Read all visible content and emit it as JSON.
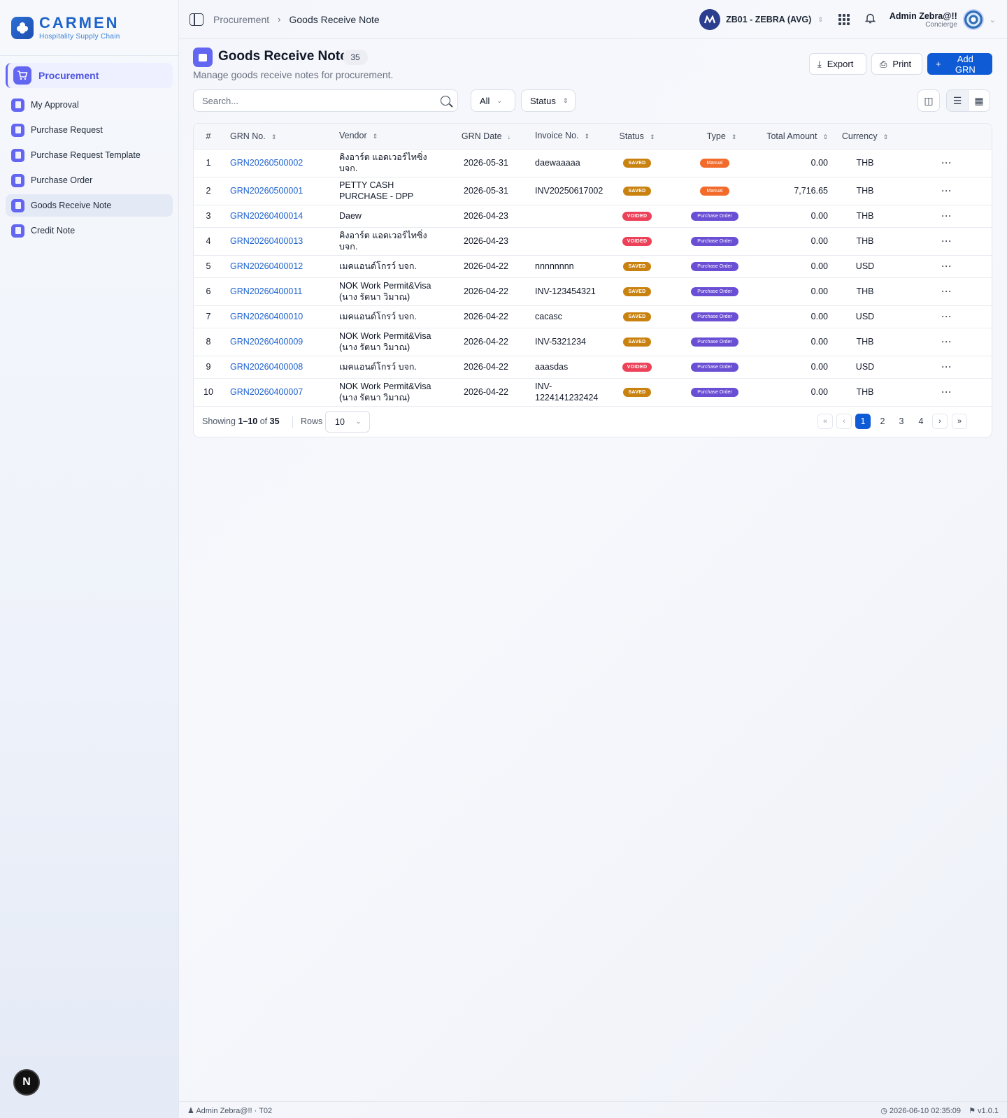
{
  "brand": {
    "name": "CARMEN",
    "tagline": "Hospitality Supply Chain"
  },
  "sidebar": {
    "section": "Procurement",
    "items": [
      {
        "label": "My Approval"
      },
      {
        "label": "Purchase Request"
      },
      {
        "label": "Purchase Request Template"
      },
      {
        "label": "Purchase Order"
      },
      {
        "label": "Goods Receive Note",
        "active": true
      },
      {
        "label": "Credit Note"
      }
    ]
  },
  "topbar": {
    "breadcrumb": [
      "Procurement",
      "Goods Receive Note"
    ],
    "business_unit": "ZB01 - ZEBRA (AVG)",
    "user_name": "Admin Zebra@!!",
    "user_role": "Concierge"
  },
  "page": {
    "title": "Goods Receive Note",
    "count": "35",
    "subtitle": "Manage goods receive notes for procurement.",
    "export_label": "Export",
    "print_label": "Print",
    "add_label": "Add GRN"
  },
  "filters": {
    "search_placeholder": "Search...",
    "scope": "All",
    "status": "Status"
  },
  "table": {
    "columns": [
      "#",
      "GRN No.",
      "Vendor",
      "GRN Date",
      "Invoice No.",
      "Status",
      "Type",
      "Total Amount",
      "Currency"
    ],
    "rows": [
      {
        "num": "1",
        "grn": "GRN20260500002",
        "vendor_1": "คิงอาร์ต แอดเวอร์ไทซิ่ง",
        "vendor_2": "บจก.",
        "date": "2026-05-31",
        "inv_1": "daewaaaaa",
        "inv_2": "",
        "status": "SAVED",
        "type": "Manual",
        "total": "0.00",
        "currency": "THB"
      },
      {
        "num": "2",
        "grn": "GRN20260500001",
        "vendor_1": "PETTY CASH",
        "vendor_2": "PURCHASE - DPP",
        "date": "2026-05-31",
        "inv_1": "INV20250617002",
        "inv_2": "",
        "status": "SAVED",
        "type": "Manual",
        "total": "7,716.65",
        "currency": "THB"
      },
      {
        "num": "3",
        "grn": "GRN20260400014",
        "vendor_1": "Daew",
        "vendor_2": "",
        "date": "2026-04-23",
        "inv_1": "",
        "inv_2": "",
        "status": "VOIDED",
        "type": "Purchase Order",
        "total": "0.00",
        "currency": "THB"
      },
      {
        "num": "4",
        "grn": "GRN20260400013",
        "vendor_1": "คิงอาร์ต แอดเวอร์ไทซิ่ง",
        "vendor_2": "บจก.",
        "date": "2026-04-23",
        "inv_1": "",
        "inv_2": "",
        "status": "VOIDED",
        "type": "Purchase Order",
        "total": "0.00",
        "currency": "THB"
      },
      {
        "num": "5",
        "grn": "GRN20260400012",
        "vendor_1": "เมคแอนด์โกรว์ บจก.",
        "vendor_2": "",
        "date": "2026-04-22",
        "inv_1": "nnnnnnnn",
        "inv_2": "",
        "status": "SAVED",
        "type": "Purchase Order",
        "total": "0.00",
        "currency": "USD"
      },
      {
        "num": "6",
        "grn": "GRN20260400011",
        "vendor_1": "NOK Work Permit&Visa",
        "vendor_2": "(นาง รัตนา วิมาณ)",
        "date": "2026-04-22",
        "inv_1": "INV-123454321",
        "inv_2": "",
        "status": "SAVED",
        "type": "Purchase Order",
        "total": "0.00",
        "currency": "THB"
      },
      {
        "num": "7",
        "grn": "GRN20260400010",
        "vendor_1": "เมคแอนด์โกรว์ บจก.",
        "vendor_2": "",
        "date": "2026-04-22",
        "inv_1": "cacasc",
        "inv_2": "",
        "status": "SAVED",
        "type": "Purchase Order",
        "total": "0.00",
        "currency": "USD"
      },
      {
        "num": "8",
        "grn": "GRN20260400009",
        "vendor_1": "NOK Work Permit&Visa",
        "vendor_2": "(นาง รัตนา วิมาณ)",
        "date": "2026-04-22",
        "inv_1": "INV-5321234",
        "inv_2": "",
        "status": "SAVED",
        "type": "Purchase Order",
        "total": "0.00",
        "currency": "THB"
      },
      {
        "num": "9",
        "grn": "GRN20260400008",
        "vendor_1": "เมคแอนด์โกรว์ บจก.",
        "vendor_2": "",
        "date": "2026-04-22",
        "inv_1": "aaasdas",
        "inv_2": "",
        "status": "VOIDED",
        "type": "Purchase Order",
        "total": "0.00",
        "currency": "USD"
      },
      {
        "num": "10",
        "grn": "GRN20260400007",
        "vendor_1": "NOK Work Permit&Visa",
        "vendor_2": "(นาง รัตนา วิมาณ)",
        "date": "2026-04-22",
        "inv_1": "INV-",
        "inv_2": "1224141232424",
        "status": "SAVED",
        "type": "Purchase Order",
        "total": "0.00",
        "currency": "THB"
      }
    ]
  },
  "pagination": {
    "showing_label": "Showing",
    "range": "1–10",
    "of_label": "of",
    "total": "35",
    "rows_label": "Rows",
    "rows_value": "10",
    "pages": [
      "1",
      "2",
      "3",
      "4"
    ],
    "current": "1"
  },
  "footer": {
    "user": "Admin Zebra@!!",
    "code": "T02",
    "timestamp": "2026-06-10 02:35:09",
    "version": "v1.0.1"
  },
  "dev_badge": "N"
}
